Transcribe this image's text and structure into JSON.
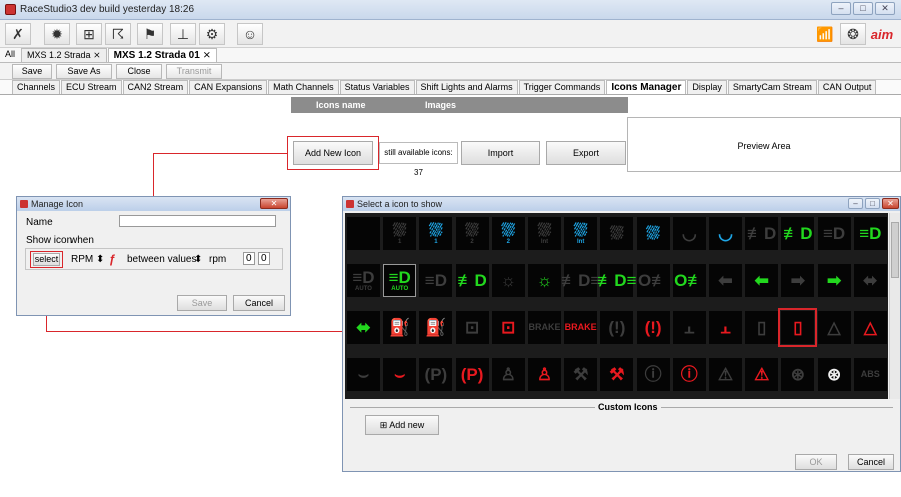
{
  "app": {
    "title": "RaceStudio3 dev  build yesterday 18:26"
  },
  "doc_tabs": [
    {
      "label": "All"
    },
    {
      "label": "MXS 1.2 Strada"
    },
    {
      "label": "MXS 1.2 Strada 01"
    }
  ],
  "actions": {
    "save": "Save",
    "save_as": "Save As",
    "close": "Close",
    "transmit": "Transmit"
  },
  "section_tabs": [
    "Channels",
    "ECU Stream",
    "CAN2 Stream",
    "CAN Expansions",
    "Math Channels",
    "Status Variables",
    "Shift Lights and Alarms",
    "Trigger Commands",
    "Icons Manager",
    "Display",
    "SmartyCam Stream",
    "CAN Output"
  ],
  "icons_manager": {
    "col_name": "Icons name",
    "col_images": "Images",
    "add_new_icon": "Add New Icon",
    "available": "still available icons: 37",
    "import": "Import",
    "export": "Export",
    "preview_area": "Preview Area"
  },
  "manage_icon": {
    "title": "Manage Icon",
    "name_label": "Name",
    "name_value": "",
    "show_icon_label": "Show icon",
    "when_label": "when",
    "select": "select",
    "channel": "RPM",
    "condition": "between values",
    "unit": "rpm",
    "value_low": "0",
    "value_high": "0",
    "save": "Save",
    "cancel": "Cancel"
  },
  "select_icon": {
    "title": "Select a icon to show",
    "custom_icons": "Custom Icons",
    "add_new": "Add new",
    "ok": "OK",
    "cancel": "Cancel",
    "rows": [
      [
        {
          "g": "",
          "c": "grey"
        },
        {
          "g": "⛆",
          "c": "grey",
          "s": "1"
        },
        {
          "g": "⛆",
          "c": "cyan",
          "s": "1"
        },
        {
          "g": "⛆",
          "c": "grey",
          "s": "2"
        },
        {
          "g": "⛆",
          "c": "cyan",
          "s": "2"
        },
        {
          "g": "⛆",
          "c": "grey",
          "s": "Int"
        },
        {
          "g": "⛆",
          "c": "cyan",
          "s": "Int"
        },
        {
          "g": "⛆",
          "c": "grey"
        },
        {
          "g": "⛆",
          "c": "cyan"
        },
        {
          "g": "◡",
          "c": "grey"
        },
        {
          "g": "◡",
          "c": "cyan"
        },
        {
          "g": "≢D",
          "c": "grey"
        },
        {
          "g": "≢D",
          "c": "green"
        },
        {
          "g": "≡D",
          "c": "grey"
        },
        {
          "g": "≡D",
          "c": "green"
        }
      ],
      [
        {
          "g": "≡D",
          "c": "grey",
          "s": "AUTO"
        },
        {
          "g": "≡D",
          "c": "green",
          "s": "AUTO",
          "sel": true
        },
        {
          "g": "≡D",
          "c": "grey"
        },
        {
          "g": "≢D",
          "c": "green"
        },
        {
          "g": "☼",
          "c": "grey"
        },
        {
          "g": "☼",
          "c": "green"
        },
        {
          "g": "≢D≡",
          "c": "grey"
        },
        {
          "g": "≢D≡",
          "c": "green"
        },
        {
          "g": "O≢",
          "c": "grey"
        },
        {
          "g": "O≢",
          "c": "green"
        },
        {
          "g": "⬅",
          "c": "grey"
        },
        {
          "g": "⬅",
          "c": "green"
        },
        {
          "g": "➡",
          "c": "grey"
        },
        {
          "g": "➡",
          "c": "green"
        },
        {
          "g": "⬌",
          "c": "grey"
        }
      ],
      [
        {
          "g": "⬌",
          "c": "green"
        },
        {
          "g": "⛽",
          "c": "grey"
        },
        {
          "g": "⛽",
          "c": "red"
        },
        {
          "g": "⊡",
          "c": "grey"
        },
        {
          "g": "⊡",
          "c": "red"
        },
        {
          "g": "BRAKE",
          "c": "grey",
          "small": true
        },
        {
          "g": "BRAKE",
          "c": "red",
          "small": true
        },
        {
          "g": "(!)",
          "c": "grey"
        },
        {
          "g": "(!)",
          "c": "red"
        },
        {
          "g": "⫠",
          "c": "grey"
        },
        {
          "g": "⫠",
          "c": "red"
        },
        {
          "g": "▯",
          "c": "grey"
        },
        {
          "g": "▯",
          "c": "red",
          "red_box": true
        },
        {
          "g": "△",
          "c": "grey"
        },
        {
          "g": "△",
          "c": "red"
        }
      ],
      [
        {
          "g": "⌣",
          "c": "grey"
        },
        {
          "g": "⌣",
          "c": "red"
        },
        {
          "g": "(P)",
          "c": "grey"
        },
        {
          "g": "(P)",
          "c": "red"
        },
        {
          "g": "♙",
          "c": "grey"
        },
        {
          "g": "♙",
          "c": "red"
        },
        {
          "g": "⚒",
          "c": "grey"
        },
        {
          "g": "⚒",
          "c": "red"
        },
        {
          "g": "ⓘ",
          "c": "grey"
        },
        {
          "g": "ⓘ",
          "c": "red"
        },
        {
          "g": "⚠",
          "c": "grey"
        },
        {
          "g": "⚠",
          "c": "red"
        },
        {
          "g": "⊛",
          "c": "grey"
        },
        {
          "g": "⊛",
          "c": "white"
        },
        {
          "g": "ABS",
          "c": "grey",
          "small": true
        }
      ]
    ]
  },
  "colors": {
    "accent_red": "#d9262b",
    "icon_green": "#22d81e",
    "icon_red": "#e8191f",
    "icon_cyan": "#1ea6e6"
  }
}
